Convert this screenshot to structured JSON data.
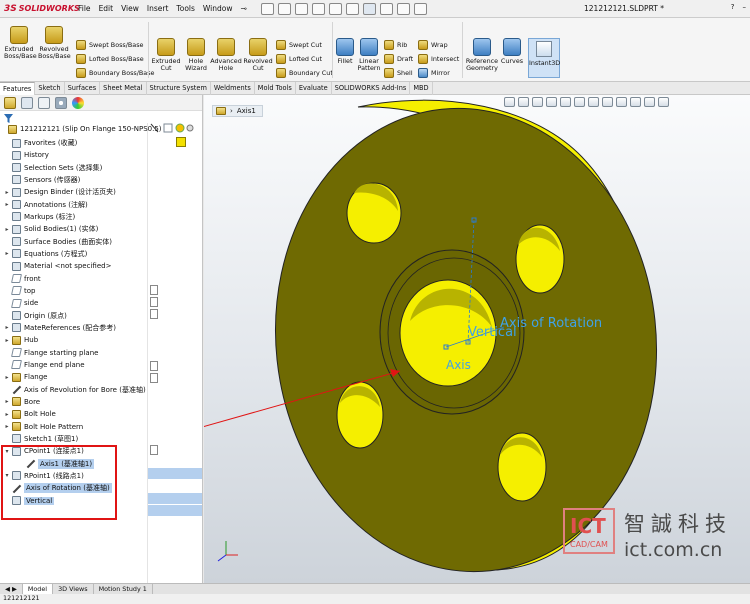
{
  "app": {
    "brand": "SOLIDWORKS",
    "document_title": "121212121.SLDPRT *"
  },
  "menus": [
    "File",
    "Edit",
    "View",
    "Insert",
    "Tools",
    "Window"
  ],
  "ribbon": {
    "extruded_boss": "Extruded Boss/Base",
    "revolved_boss": "Revolved Boss/Base",
    "swept_boss": "Swept Boss/Base",
    "lofted_boss": "Lofted Boss/Base",
    "boundary_boss": "Boundary Boss/Base",
    "extruded_cut": "Extruded Cut",
    "hole_wizard": "Hole Wizard",
    "advanced_hole": "Advanced Hole",
    "revolved_cut": "Revolved Cut",
    "swept_cut": "Swept Cut",
    "lofted_cut": "Lofted Cut",
    "boundary_cut": "Boundary Cut",
    "fillet": "Fillet",
    "linear_pattern": "Linear Pattern",
    "rib": "Rib",
    "draft": "Draft",
    "shell": "Shell",
    "wrap": "Wrap",
    "intersect": "Intersect",
    "mirror": "Mirror",
    "reference_geometry": "Reference Geometry",
    "curves": "Curves",
    "instant3d": "Instant3D"
  },
  "command_tabs": [
    "Features",
    "Sketch",
    "Surfaces",
    "Sheet Metal",
    "Structure System",
    "Weldments",
    "Mold Tools",
    "Evaluate",
    "SOLIDWORKS Add-Ins",
    "MBD"
  ],
  "tree": {
    "root": "121212121 (Slip On Flange 150-NPS0.5)",
    "items": [
      "Favorites (收藏)",
      "History",
      "Selection Sets (选择集)",
      "Sensors (传感器)",
      "Design Binder (设计活页夹)",
      "Annotations (注解)",
      "Markups (标注)",
      "Solid Bodies(1) (实体)",
      "Surface Bodies (曲面实体)",
      "Equations (方程式)",
      "Material <not specified>",
      "front",
      "top",
      "side",
      "Origin (原点)",
      "MateReferences (配合参考)",
      "Hub",
      "Flange starting plane",
      "Flange end plane",
      "Flange",
      "Axis of Revolution for Bore (基准轴)",
      "Bore",
      "Bolt Hole",
      "Bolt Hole Pattern",
      "Sketch1 (草图1)",
      "CPoint1 (连接点1)",
      "Axis1 (基准轴1)",
      "RPoint1 (线路点1)",
      "Axis of Rotation (基准轴)",
      "Vertical"
    ]
  },
  "viewport": {
    "breadcrumb": "Axis1",
    "label_axis_of_rotation": "Axis of Rotation",
    "label_vertical": "Vertical",
    "label_axis": "Axis"
  },
  "watermark": {
    "logo_text": "ICT",
    "logo_sub": "CAD/CAM",
    "cn_text": "智誠科技",
    "url": "ict.com.cn"
  },
  "bottom_tabs": [
    "Model",
    "3D Views",
    "Motion Study 1"
  ],
  "status_text": "121212121",
  "colors": {
    "part_face": "#f5ef00",
    "part_side": "#6f6a02",
    "callout_red": "#e01414",
    "sketch_blue": "#3fa2e6",
    "selection": "#b4cfee"
  }
}
